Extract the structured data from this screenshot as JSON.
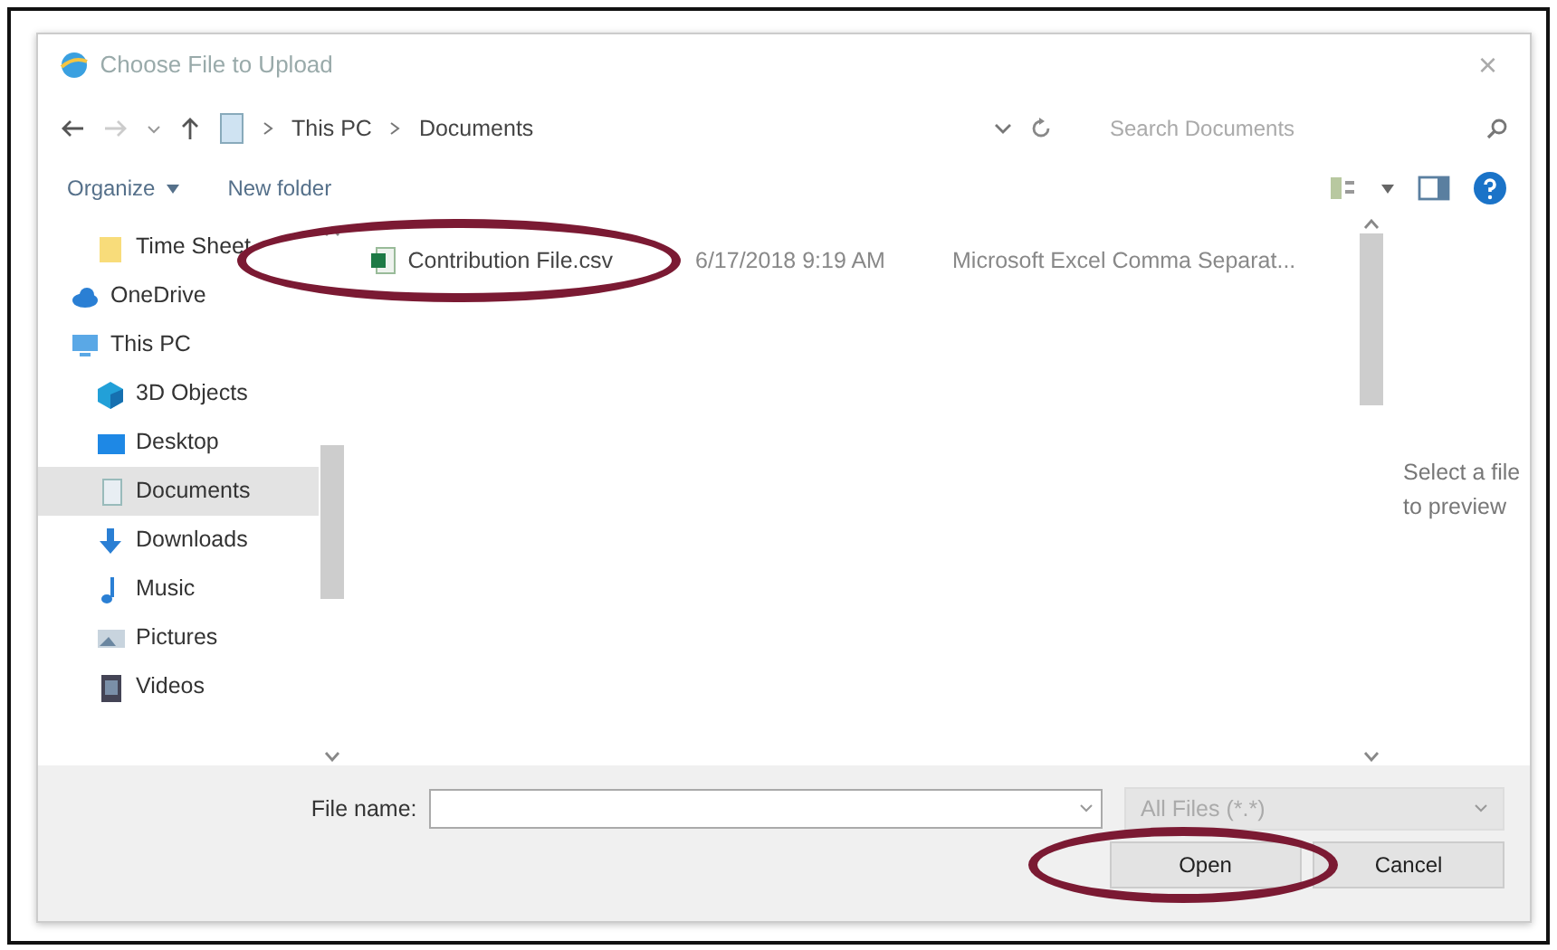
{
  "window": {
    "title": "Choose File to Upload",
    "close": "×"
  },
  "address": {
    "segments": [
      "This PC",
      "Documents"
    ]
  },
  "search": {
    "placeholder": "Search Documents"
  },
  "toolbar": {
    "organize": "Organize",
    "new_folder": "New folder"
  },
  "nav_pane": {
    "items": [
      {
        "label": "Time Sheet",
        "kind": "folder",
        "selected": false
      },
      {
        "label": "OneDrive",
        "kind": "cloud",
        "selected": false
      },
      {
        "label": "This PC",
        "kind": "computer",
        "selected": false,
        "children": [
          {
            "label": "3D Objects",
            "kind": "cube",
            "selected": false
          },
          {
            "label": "Desktop",
            "kind": "desktop",
            "selected": false
          },
          {
            "label": "Documents",
            "kind": "document",
            "selected": true
          },
          {
            "label": "Downloads",
            "kind": "download",
            "selected": false
          },
          {
            "label": "Music",
            "kind": "music",
            "selected": false
          },
          {
            "label": "Pictures",
            "kind": "pictures",
            "selected": false
          },
          {
            "label": "Videos",
            "kind": "videos",
            "selected": false
          }
        ]
      }
    ]
  },
  "files": [
    {
      "name": "Contribution File.csv",
      "date_modified": "6/17/2018 9:19 AM",
      "type": "Microsoft Excel Comma Separat...",
      "circled": true
    }
  ],
  "preview": {
    "text": "Select a file to preview"
  },
  "footer": {
    "file_name_label": "File name:",
    "filter": "All Files (*.*)",
    "buttons": [
      {
        "label": "Open",
        "circled": true
      },
      {
        "label": "Cancel",
        "circled": false
      }
    ]
  }
}
